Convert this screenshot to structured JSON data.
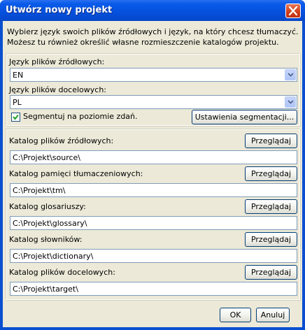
{
  "window": {
    "title": "Utwórz nowy projekt",
    "title_color": "#ffffff",
    "titlebar_color": "#0550dd",
    "close_icon": "close-icon"
  },
  "intro": {
    "line1": "Wybierz język swoich plików źródłowych i język, na który chcesz tłumaczyć.",
    "line2": "Możesz tu również określić własne rozmieszczenie katalogów projektu."
  },
  "languages": {
    "source_label": "Język plików źródłowych:",
    "source_value": "EN",
    "target_label": "Język plików docelowych:",
    "target_value": "PL",
    "segment_label": "Segmentuj na poziomie zdań.",
    "segment_checked": true,
    "segment_settings_button": "Ustawienia segmentacji..."
  },
  "folders": [
    {
      "label": "Katalog plików źródłowych:",
      "path": "C:\\Projekt\\source\\",
      "button": "Przeglądaj"
    },
    {
      "label": "Katalog pamięci tłumaczeniowych:",
      "path": "C:\\Projekt\\tm\\",
      "button": "Przeglądaj"
    },
    {
      "label": "Katalog glosariuszy:",
      "path": "C:\\Projekt\\glossary\\",
      "button": "Przeglądaj"
    },
    {
      "label": "Katalog słowników:",
      "path": "C:\\Projekt\\dictionary\\",
      "button": "Przeglądaj"
    },
    {
      "label": "Katalog plików docelowych:",
      "path": "C:\\Projekt\\target\\",
      "button": "Przeglądaj"
    }
  ],
  "footer": {
    "ok": "OK",
    "cancel": "Anuluj"
  }
}
